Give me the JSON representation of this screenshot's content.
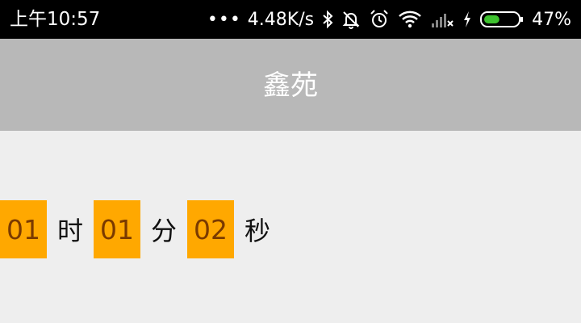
{
  "status_bar": {
    "time": "上午10:57",
    "dots": "•••",
    "net_speed": "4.48K/s",
    "battery_percent": "47%",
    "battery_level": 0.47,
    "battery_color": "#3ec22f",
    "icons": [
      "bluetooth-icon",
      "mute-icon",
      "alarm-icon",
      "wifi-icon",
      "cellular-signal-icon",
      "charging-icon",
      "battery-icon"
    ]
  },
  "app_bar": {
    "title": "鑫苑",
    "background": "#b8b8b8"
  },
  "countdown": {
    "hours": "01",
    "hours_unit": "时",
    "minutes": "01",
    "minutes_unit": "分",
    "seconds": "02",
    "seconds_unit": "秒",
    "box_color": "#ffa800"
  }
}
